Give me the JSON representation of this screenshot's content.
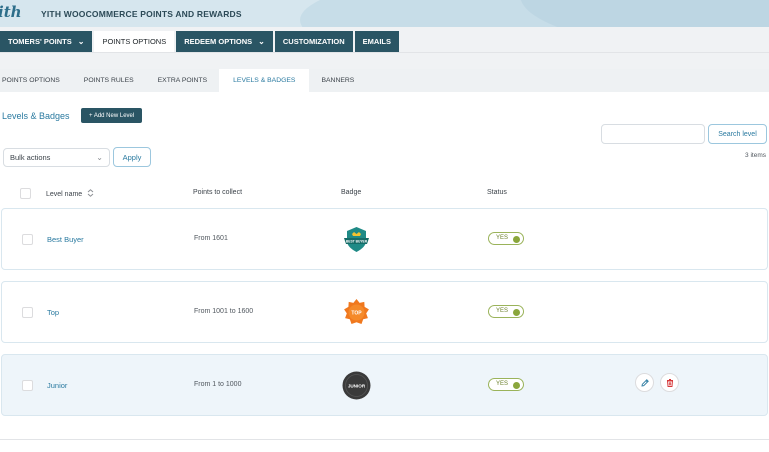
{
  "header": {
    "logo_text": "ith",
    "plugin_title": "YITH WOOCOMMERCE POINTS AND REWARDS"
  },
  "main_nav": [
    {
      "label": "TOMERS' POINTS",
      "has_dropdown": true,
      "active": false
    },
    {
      "label": "POINTS OPTIONS",
      "has_dropdown": false,
      "active": true
    },
    {
      "label": "REDEEM OPTIONS",
      "has_dropdown": true,
      "active": false
    },
    {
      "label": "CUSTOMIZATION",
      "has_dropdown": false,
      "active": false
    },
    {
      "label": "EMAILS",
      "has_dropdown": false,
      "active": false
    }
  ],
  "sub_nav": [
    {
      "label": "POINTS OPTIONS",
      "active": false
    },
    {
      "label": "POINTS RULES",
      "active": false
    },
    {
      "label": "EXTRA POINTS",
      "active": false
    },
    {
      "label": "LEVELS & BADGES",
      "active": true
    },
    {
      "label": "BANNERS",
      "active": false
    }
  ],
  "section": {
    "title": "Levels & Badges",
    "add_button": "+ Add New Level"
  },
  "search": {
    "value": "",
    "button": "Search level"
  },
  "items_count": "3 items",
  "bulk": {
    "selected": "Bulk actions",
    "apply": "Apply"
  },
  "table": {
    "columns": {
      "name": "Level name",
      "sort_icon": "sort-arrows-icon",
      "points": "Points to collect",
      "badge": "Badge",
      "status": "Status"
    },
    "rows": [
      {
        "name": "Best Buyer",
        "points": "From 1601",
        "badge_text": "BEST BUYER",
        "badge_shape": "shield",
        "badge_color": "#1f8a86",
        "status": "YES"
      },
      {
        "name": "Top",
        "points": "From 1001 to 1600",
        "badge_text": "TOP",
        "badge_shape": "burst",
        "badge_color": "#f0781e",
        "status": "YES"
      },
      {
        "name": "Junior",
        "points": "From 1 to 1000",
        "badge_text": "JUNIOR",
        "badge_shape": "circle",
        "badge_color": "#3a3a3a",
        "status": "YES"
      }
    ]
  },
  "row_actions": {
    "edit_icon": "pencil-icon",
    "delete_icon": "trash-icon"
  },
  "colors": {
    "accent": "#2a7aa0",
    "nav_bg": "#2a5564",
    "toggle_on": "#8aa63c",
    "edit": "#2a7aa0",
    "delete": "#d63638"
  }
}
